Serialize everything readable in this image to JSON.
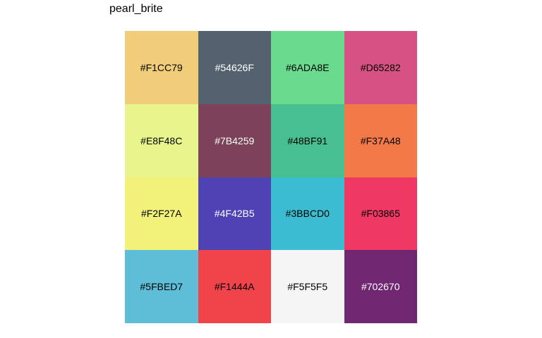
{
  "chart_data": {
    "type": "heatmap",
    "title": "pearl_brite",
    "rows": 4,
    "cols": 4,
    "cells": [
      {
        "label": "#F1CC79",
        "color": "#F1CC79",
        "text_color": "#000000"
      },
      {
        "label": "#54626F",
        "color": "#54626F",
        "text_color": "#FFFFFF"
      },
      {
        "label": "#6ADA8E",
        "color": "#6ADA8E",
        "text_color": "#000000"
      },
      {
        "label": "#D65282",
        "color": "#D65282",
        "text_color": "#000000"
      },
      {
        "label": "#E8F48C",
        "color": "#E8F48C",
        "text_color": "#000000"
      },
      {
        "label": "#7B4259",
        "color": "#7B4259",
        "text_color": "#FFFFFF"
      },
      {
        "label": "#48BF91",
        "color": "#48BF91",
        "text_color": "#000000"
      },
      {
        "label": "#F37A48",
        "color": "#F37A48",
        "text_color": "#000000"
      },
      {
        "label": "#F2F27A",
        "color": "#F2F27A",
        "text_color": "#000000"
      },
      {
        "label": "#4F42B5",
        "color": "#4F42B5",
        "text_color": "#FFFFFF"
      },
      {
        "label": "#3BBCD0",
        "color": "#3BBCD0",
        "text_color": "#000000"
      },
      {
        "label": "#F03865",
        "color": "#F03865",
        "text_color": "#000000"
      },
      {
        "label": "#5FBED7",
        "color": "#5FBED7",
        "text_color": "#000000"
      },
      {
        "label": "#F1444A",
        "color": "#F1444A",
        "text_color": "#000000"
      },
      {
        "label": "#F5F5F5",
        "color": "#F5F5F5",
        "text_color": "#000000"
      },
      {
        "label": "#702670",
        "color": "#702670",
        "text_color": "#FFFFFF"
      }
    ]
  }
}
